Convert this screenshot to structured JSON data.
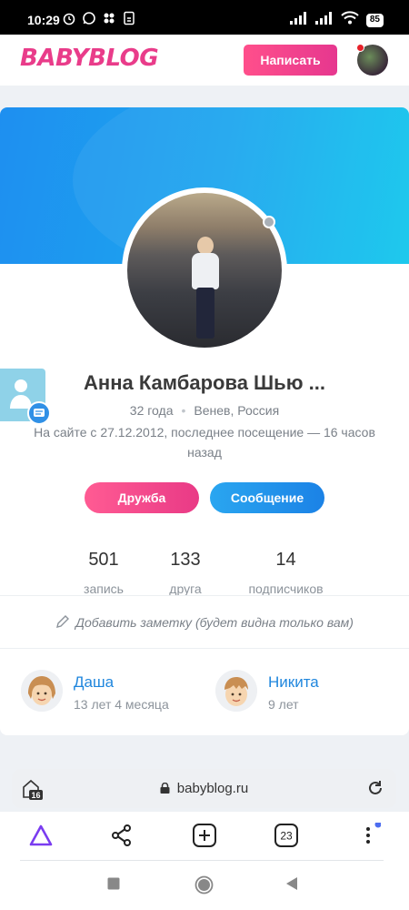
{
  "status_bar": {
    "time": "10:29",
    "battery": "85"
  },
  "header": {
    "logo": "BABYBLOG",
    "write_button": "Написать"
  },
  "profile": {
    "name": "Анна Камбарова Шью ...",
    "age": "32 года",
    "location": "Венев, Россия",
    "since": "На сайте с 27.12.2012, последнее посещение — 16 часов назад",
    "friend_button": "Дружба",
    "message_button": "Сообщение"
  },
  "stats": [
    {
      "value": "501",
      "label": "запись"
    },
    {
      "value": "133",
      "label": "друга"
    },
    {
      "value": "14",
      "label": "подписчиков"
    }
  ],
  "note": {
    "text": "Добавить заметку (будет видна только вам)"
  },
  "children": [
    {
      "name": "Даша",
      "age": "13 лет 4 месяца",
      "icon": "girl-face-icon"
    },
    {
      "name": "Никита",
      "age": "9 лет",
      "icon": "boy-face-icon"
    }
  ],
  "browser": {
    "url": "babyblog.ru",
    "tab_history_count": "16",
    "tabs_count": "23"
  },
  "colors": {
    "accent_pink": "#e93c8a",
    "accent_blue": "#1f86dd",
    "cover_gradient_start": "#1e8ff0",
    "cover_gradient_end": "#10c6ec"
  }
}
